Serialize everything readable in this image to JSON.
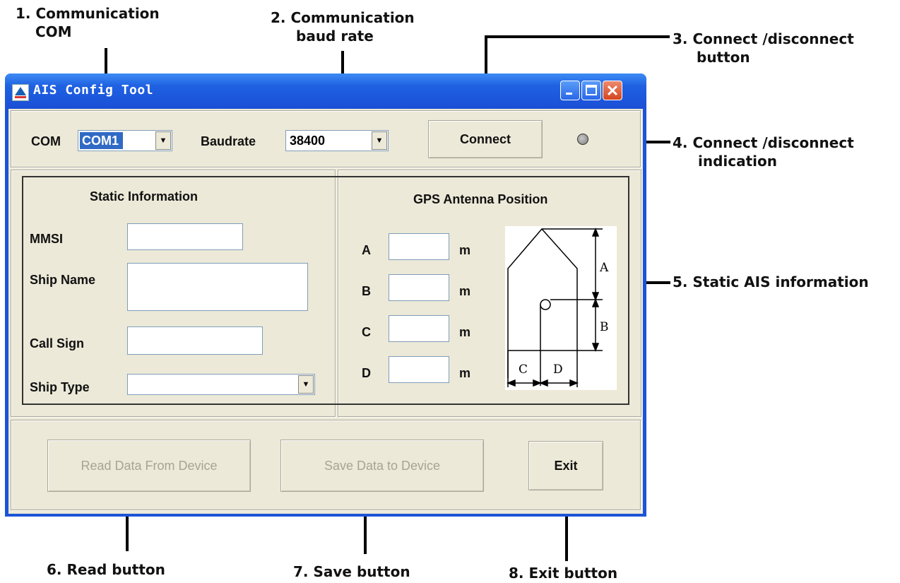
{
  "annotations": {
    "n1_line1": "1. Communication",
    "n1_line2": "COM",
    "n2_line1": "2. Communication",
    "n2_line2": "baud rate",
    "n3_line1": "3. Connect /disconnect",
    "n3_line2": "button",
    "n4_line1": "4. Connect /disconnect",
    "n4_line2": "indication",
    "n5": "5. Static AIS information",
    "n6": "6. Read button",
    "n7": "7. Save button",
    "n8": "8. Exit button"
  },
  "window": {
    "title": "AIS Config Tool"
  },
  "connection": {
    "com_label": "COM",
    "com_value": "COM1",
    "baud_label": "Baudrate",
    "baud_value": "38400",
    "connect_label": "Connect",
    "indicator_state": "disconnected"
  },
  "static_info": {
    "heading": "Static Information",
    "mmsi_label": "MMSI",
    "mmsi_value": "",
    "ship_name_label": "Ship Name",
    "ship_name_value": "",
    "call_sign_label": "Call Sign",
    "call_sign_value": "",
    "ship_type_label": "Ship Type",
    "ship_type_value": ""
  },
  "gps": {
    "heading": "GPS Antenna Position",
    "fields": [
      {
        "label": "A",
        "value": "",
        "unit": "m"
      },
      {
        "label": "B",
        "value": "",
        "unit": "m"
      },
      {
        "label": "C",
        "value": "",
        "unit": "m"
      },
      {
        "label": "D",
        "value": "",
        "unit": "m"
      }
    ],
    "diagram_labels": {
      "a": "A",
      "b": "B",
      "c": "C",
      "d": "D"
    }
  },
  "actions": {
    "read_label": "Read Data From Device",
    "save_label": "Save Data to Device",
    "exit_label": "Exit"
  },
  "colors": {
    "titlebar": "#1f61e2",
    "dialog_bg": "#ece9d8",
    "disabled_text": "#a6a496"
  }
}
